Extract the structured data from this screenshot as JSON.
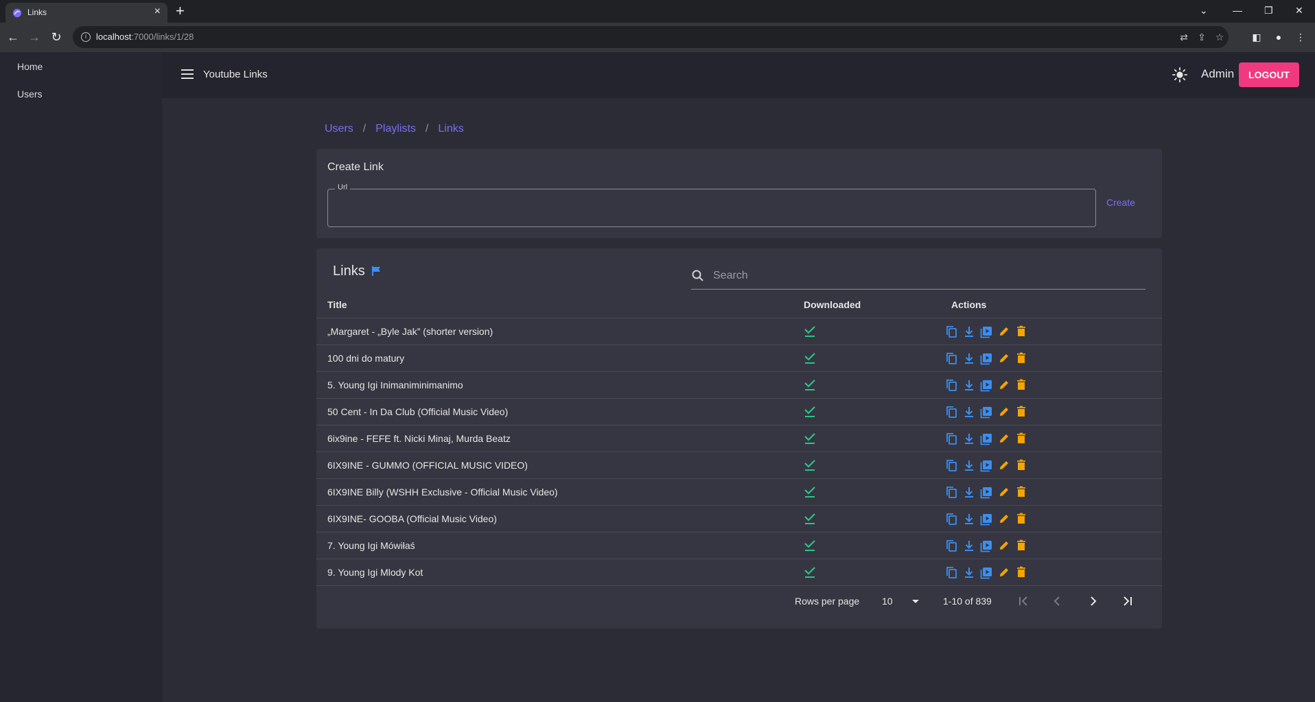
{
  "browser": {
    "tab_title": "Links",
    "url_host": "localhost",
    "url_path": ":7000/links/1/28"
  },
  "sidebar": {
    "items": [
      {
        "label": "Home"
      },
      {
        "label": "Users"
      }
    ]
  },
  "appbar": {
    "title": "Youtube Links",
    "user": "Admin",
    "logout_label": "LOGOUT"
  },
  "breadcrumb": {
    "items": [
      "Users",
      "Playlists",
      "Links"
    ],
    "separator": "/"
  },
  "create_link": {
    "title": "Create Link",
    "url_label": "Url",
    "url_value": "",
    "create_label": "Create"
  },
  "links_table": {
    "title": "Links",
    "search_placeholder": "Search",
    "columns": {
      "title": "Title",
      "downloaded": "Downloaded",
      "actions": "Actions"
    },
    "rows": [
      {
        "title": "„Margaret - „Byle Jak” (shorter version)",
        "downloaded": true
      },
      {
        "title": "100 dni do matury",
        "downloaded": true
      },
      {
        "title": "5. Young Igi Inimaniminimanimo",
        "downloaded": true
      },
      {
        "title": "50 Cent - In Da Club (Official Music Video)",
        "downloaded": true
      },
      {
        "title": "6ix9ine - FEFE ft. Nicki Minaj, Murda Beatz",
        "downloaded": true
      },
      {
        "title": "6IX9INE - GUMMO (OFFICIAL MUSIC VIDEO)",
        "downloaded": true
      },
      {
        "title": "6IX9INE Billy (WSHH Exclusive - Official Music Video)",
        "downloaded": true
      },
      {
        "title": "6IX9INE- GOOBA (Official Music Video)",
        "downloaded": true
      },
      {
        "title": "7. Young Igi Mówiłaś",
        "downloaded": true
      },
      {
        "title": "9. Young Igi Mlody Kot",
        "downloaded": true
      }
    ],
    "row_actions": [
      "copy-icon",
      "download-icon",
      "video-library-icon",
      "edit-icon",
      "delete-icon"
    ]
  },
  "pagination": {
    "rows_per_page_label": "Rows per page",
    "rows_per_page": "10",
    "range": "1-10 of 839"
  },
  "colors": {
    "accent": "#7b6df2",
    "logout": "#f0397e",
    "action_blue": "#3a8ff0",
    "action_orange": "#f5a500",
    "check_green": "#2bc48a"
  }
}
